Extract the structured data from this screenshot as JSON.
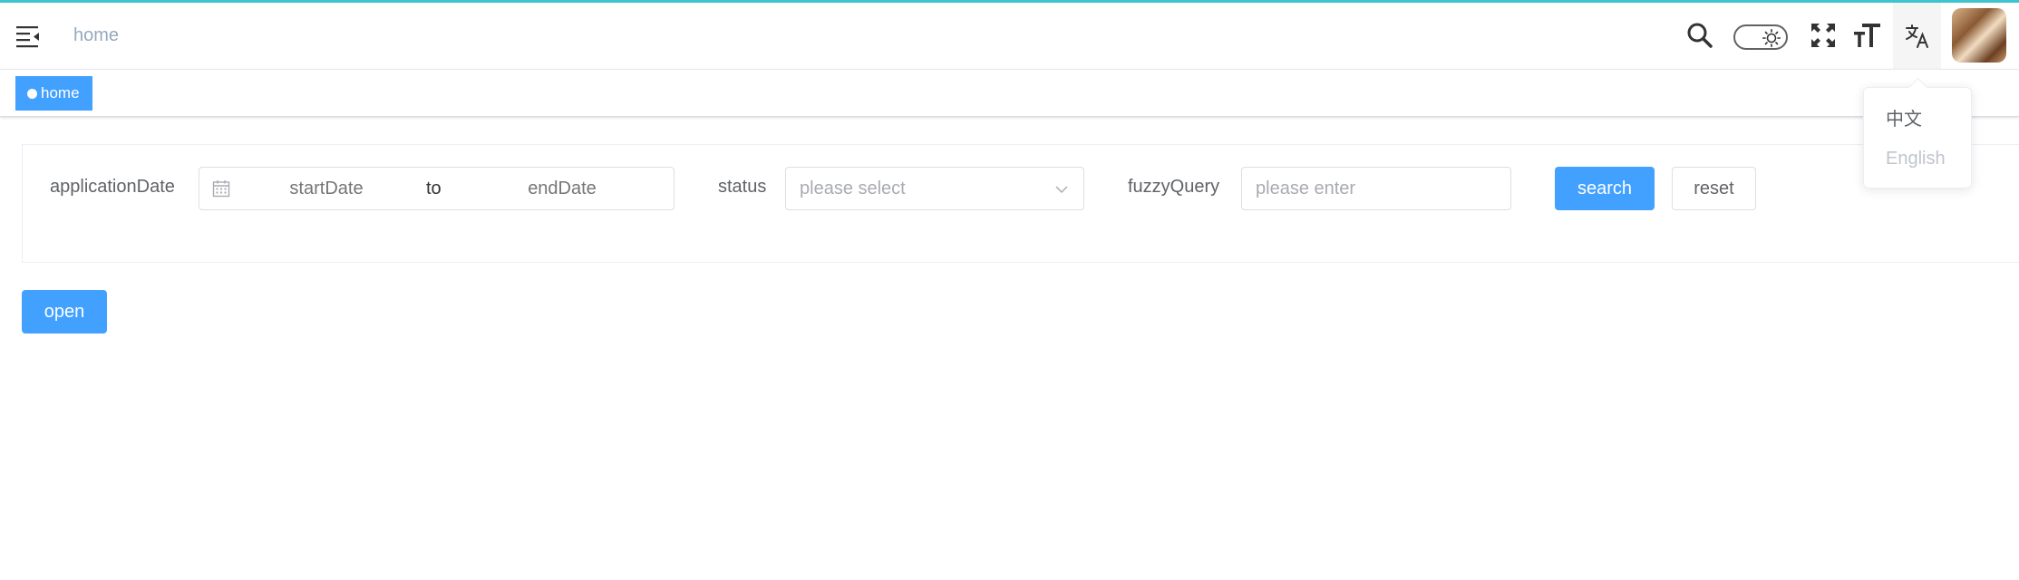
{
  "navbar": {
    "breadcrumb": "home",
    "icons": {
      "menu": "hamburger-icon",
      "search": "search-icon",
      "theme": "theme-toggle-sun-icon",
      "fullscreen": "fullscreen-icon",
      "size": "text-size-icon",
      "language": "translate-icon"
    },
    "accent_color": "#3ec6cf"
  },
  "tags_view": {
    "tags": [
      {
        "label": "home",
        "active": true
      }
    ],
    "active_color": "#42a0ff"
  },
  "language_menu": {
    "items": [
      {
        "label": "中文",
        "selected": false
      },
      {
        "label": "English",
        "selected": true
      }
    ]
  },
  "filters": {
    "application_date": {
      "label": "applicationDate",
      "start_placeholder": "startDate",
      "separator": "to",
      "end_placeholder": "endDate"
    },
    "status": {
      "label": "status",
      "placeholder": "please select"
    },
    "fuzzy_query": {
      "label": "fuzzyQuery",
      "placeholder": "please enter"
    },
    "search_label": "search",
    "reset_label": "reset"
  },
  "actions": {
    "open_label": "open"
  }
}
